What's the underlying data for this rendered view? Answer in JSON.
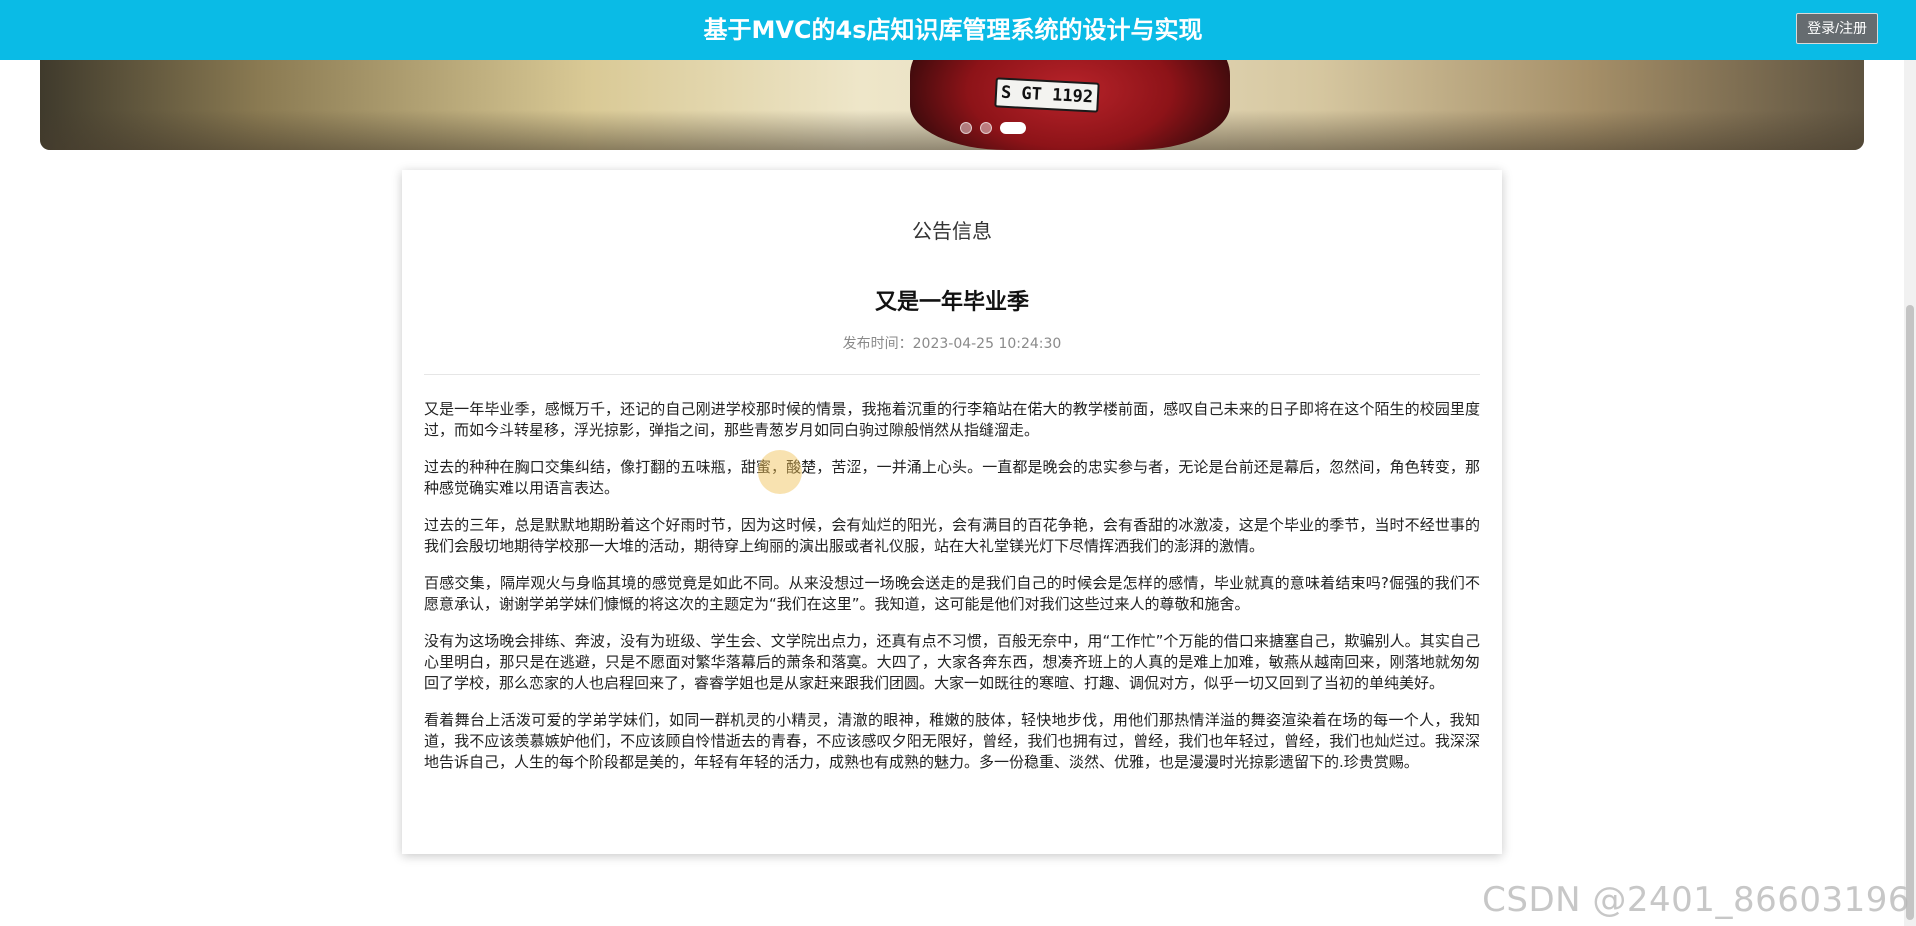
{
  "header": {
    "title": "基于MVC的4s店知识库管理系统的设计与实现",
    "login_label": "登录/注册"
  },
  "banner": {
    "plate_text": "S GT 1192",
    "slides_count": 3,
    "active_slide_index": 2
  },
  "notice": {
    "section_title": "公告信息",
    "article_title": "又是一年毕业季",
    "publish_text": "发布时间：2023-04-25 10:24:30",
    "paragraphs": [
      "又是一年毕业季，感慨万千，还记的自己刚进学校那时候的情景，我拖着沉重的行李箱站在偌大的教学楼前面，感叹自己未来的日子即将在这个陌生的校园里度过，而如今斗转星移，浮光掠影，弹指之间，那些青葱岁月如同白驹过隙般悄然从指缝溜走。",
      "过去的种种在胸口交集纠结，像打翻的五味瓶，甜蜜，酸楚，苦涩，一并涌上心头。一直都是晚会的忠实参与者，无论是台前还是幕后，忽然间，角色转变，那种感觉确实难以用语言表达。",
      "过去的三年，总是默默地期盼着这个好雨时节，因为这时候，会有灿烂的阳光，会有满目的百花争艳，会有香甜的冰激凌，这是个毕业的季节，当时不经世事的我们会殷切地期待学校那一大堆的活动，期待穿上绚丽的演出服或者礼仪服，站在大礼堂镁光灯下尽情挥洒我们的澎湃的激情。",
      "百感交集，隔岸观火与身临其境的感觉竟是如此不同。从来没想过一场晚会送走的是我们自己的时候会是怎样的感情，毕业就真的意味着结束吗?倔强的我们不愿意承认，谢谢学弟学妹们慷慨的将这次的主题定为“我们在这里”。我知道，这可能是他们对我们这些过来人的尊敬和施舍。",
      "没有为这场晚会排练、奔波，没有为班级、学生会、文学院出点力，还真有点不习惯，百般无奈中，用“工作忙”个万能的借口来搪塞自己，欺骗别人。其实自己心里明白，那只是在逃避，只是不愿面对繁华落幕后的萧条和落寞。大四了，大家各奔东西，想凑齐班上的人真的是难上加难，敏燕从越南回来，刚落地就匆匆回了学校，那么恋家的人也启程回来了，睿睿学姐也是从家赶来跟我们团圆。大家一如既往的寒暄、打趣、调侃对方，似乎一切又回到了当初的单纯美好。",
      "看着舞台上活泼可爱的学弟学妹们，如同一群机灵的小精灵，清澈的眼神，稚嫩的肢体，轻快地步伐，用他们那热情洋溢的舞姿渲染着在场的每一个人，我知道，我不应该羡慕嫉妒他们，不应该顾自怜惜逝去的青春，不应该感叹夕阳无限好，曾经，我们也拥有过，曾经，我们也年轻过，曾经，我们也灿烂过。我深深地告诉自己，人生的每个阶段都是美的，年轻有年轻的活力，成熟也有成熟的魅力。多一份稳重、淡然、优雅，也是漫漫时光掠影遗留下的.珍贵赏赐。"
    ]
  },
  "watermark": "CSDN @2401_86603196",
  "colors": {
    "header_bg": "#0abbe6",
    "login_btn_bg": "#666c70"
  }
}
